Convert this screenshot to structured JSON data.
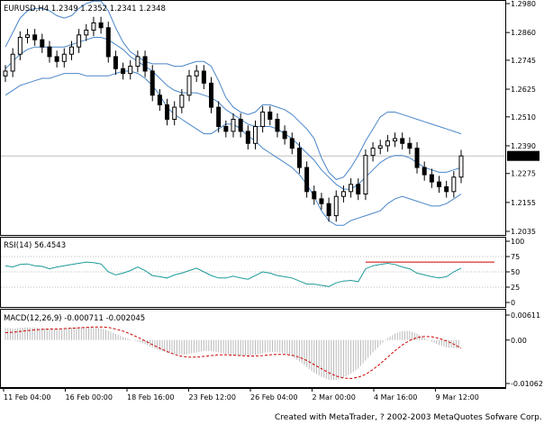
{
  "window": {
    "symbol_title": "EURUSD,H4  1.2349 1.2352 1.2341 1.2348",
    "footer": "Created with MetaTrader, ? 2002-2003 MetaQuotes Sofware Corp."
  },
  "colors": {
    "candle": "#000000",
    "bollinger": "#4a86c8",
    "rsi_line": "#1f9a9a",
    "rsi_level": "#cc0000",
    "macd_hist": "#b8b8b8",
    "macd_signal": "#cc0000",
    "current_price_bg": "#000000",
    "current_price_fg": "#ffffff",
    "grid": "#bfbfbf"
  },
  "price_pane": {
    "ticks": [
      "1.2980",
      "1.2860",
      "1.2745",
      "1.2625",
      "1.2510",
      "1.2390",
      "1.2275",
      "1.2155",
      "1.2035"
    ],
    "current_price": "1.2348"
  },
  "rsi_pane": {
    "title": "RSI(14)  56.4543",
    "ticks": [
      "100",
      "75",
      "50",
      "25",
      "0"
    ]
  },
  "macd_pane": {
    "title": "MACD(12,26,9)  -0.000711  -0.002045",
    "ticks": [
      "0.00611",
      "0.00",
      "-0.01062"
    ]
  },
  "time_axis": [
    "11 Feb 04:00",
    "16 Feb 00:00",
    "18 Feb 16:00",
    "23 Feb 12:00",
    "26 Feb 04:00",
    "2 Mar 00:00",
    "4 Mar 16:00",
    "9 Mar 12:00"
  ],
  "chart_data": {
    "type": "candlestick",
    "title": "EURUSD,H4",
    "price_range": [
      1.2035,
      1.298
    ],
    "price_series": {
      "close": [
        1.27,
        1.277,
        1.284,
        1.285,
        1.283,
        1.28,
        1.276,
        1.274,
        1.277,
        1.28,
        1.285,
        1.287,
        1.29,
        1.288,
        1.276,
        1.271,
        1.269,
        1.272,
        1.276,
        1.27,
        1.26,
        1.256,
        1.25,
        1.255,
        1.26,
        1.268,
        1.27,
        1.265,
        1.255,
        1.247,
        1.245,
        1.25,
        1.245,
        1.24,
        1.247,
        1.253,
        1.25,
        1.245,
        1.242,
        1.238,
        1.23,
        1.22,
        1.217,
        1.215,
        1.21,
        1.218,
        1.22,
        1.223,
        1.219,
        1.235,
        1.238,
        1.239,
        1.241,
        1.242,
        1.24,
        1.238,
        1.23,
        1.227,
        1.224,
        1.222,
        1.22,
        1.226,
        1.2348
      ],
      "bb_upper": [
        1.28,
        1.286,
        1.292,
        1.295,
        1.296,
        1.296,
        1.295,
        1.293,
        1.292,
        1.293,
        1.296,
        1.298,
        1.299,
        1.299,
        1.295,
        1.288,
        1.282,
        1.278,
        1.276,
        1.274,
        1.273,
        1.273,
        1.273,
        1.272,
        1.272,
        1.273,
        1.274,
        1.274,
        1.272,
        1.266,
        1.259,
        1.255,
        1.253,
        1.252,
        1.253,
        1.256,
        1.256,
        1.255,
        1.254,
        1.252,
        1.249,
        1.246,
        1.242,
        1.234,
        1.228,
        1.225,
        1.226,
        1.23,
        1.235,
        1.241,
        1.246,
        1.251,
        1.253,
        1.253,
        1.252,
        1.251,
        1.25,
        1.249,
        1.248,
        1.247,
        1.246,
        1.245,
        1.244
      ],
      "bb_mid": [
        1.271,
        1.274,
        1.277,
        1.279,
        1.28,
        1.28,
        1.28,
        1.28,
        1.28,
        1.281,
        1.282,
        1.283,
        1.284,
        1.284,
        1.283,
        1.281,
        1.279,
        1.276,
        1.274,
        1.272,
        1.27,
        1.267,
        1.264,
        1.262,
        1.261,
        1.261,
        1.261,
        1.26,
        1.259,
        1.257,
        1.254,
        1.252,
        1.25,
        1.248,
        1.247,
        1.247,
        1.247,
        1.246,
        1.244,
        1.242,
        1.239,
        1.236,
        1.233,
        1.229,
        1.226,
        1.223,
        1.221,
        1.221,
        1.223,
        1.226,
        1.229,
        1.232,
        1.234,
        1.235,
        1.235,
        1.234,
        1.232,
        1.23,
        1.229,
        1.228,
        1.228,
        1.229,
        1.23
      ],
      "bb_lower": [
        1.26,
        1.262,
        1.264,
        1.265,
        1.266,
        1.267,
        1.267,
        1.268,
        1.269,
        1.269,
        1.269,
        1.268,
        1.268,
        1.268,
        1.268,
        1.269,
        1.27,
        1.27,
        1.269,
        1.267,
        1.264,
        1.26,
        1.255,
        1.252,
        1.25,
        1.248,
        1.246,
        1.244,
        1.244,
        1.246,
        1.248,
        1.248,
        1.246,
        1.243,
        1.241,
        1.238,
        1.236,
        1.234,
        1.232,
        1.23,
        1.227,
        1.223,
        1.218,
        1.212,
        1.208,
        1.206,
        1.206,
        1.208,
        1.209,
        1.21,
        1.211,
        1.212,
        1.215,
        1.217,
        1.218,
        1.217,
        1.216,
        1.215,
        1.214,
        1.214,
        1.215,
        1.217,
        1.219
      ]
    },
    "rsi": {
      "range": [
        0,
        100
      ],
      "levels": [
        75,
        50,
        25
      ],
      "resistance_level": 66,
      "values": [
        60,
        58,
        62,
        63,
        60,
        59,
        55,
        58,
        60,
        62,
        64,
        66,
        65,
        63,
        50,
        45,
        48,
        52,
        58,
        52,
        44,
        42,
        40,
        45,
        48,
        52,
        56,
        50,
        44,
        40,
        40,
        43,
        40,
        38,
        44,
        50,
        48,
        44,
        42,
        40,
        35,
        30,
        30,
        28,
        26,
        32,
        35,
        36,
        34,
        55,
        60,
        62,
        64,
        62,
        58,
        55,
        48,
        45,
        42,
        40,
        42,
        50,
        56
      ]
    },
    "macd": {
      "range": [
        -0.01062,
        0.00611
      ],
      "histogram": [
        0.003,
        0.0028,
        0.003,
        0.0031,
        0.003,
        0.0029,
        0.0027,
        0.0027,
        0.0028,
        0.003,
        0.0031,
        0.0032,
        0.0031,
        0.0029,
        0.0023,
        0.0015,
        0.0008,
        0.0002,
        -0.0004,
        -0.001,
        -0.0018,
        -0.0025,
        -0.0031,
        -0.0034,
        -0.0036,
        -0.0034,
        -0.003,
        -0.0027,
        -0.0027,
        -0.003,
        -0.0034,
        -0.0037,
        -0.0038,
        -0.0038,
        -0.0036,
        -0.0032,
        -0.0029,
        -0.003,
        -0.0033,
        -0.004,
        -0.0052,
        -0.0066,
        -0.008,
        -0.009,
        -0.0097,
        -0.0098,
        -0.0092,
        -0.0082,
        -0.007,
        -0.005,
        -0.003,
        -0.0012,
        0.0005,
        0.0016,
        0.0022,
        0.0022,
        0.0016,
        0.0006,
        -0.0004,
        -0.0012,
        -0.0018,
        -0.002,
        -0.002
      ],
      "signal": [
        0.0018,
        0.0019,
        0.0021,
        0.0023,
        0.0025,
        0.0026,
        0.0027,
        0.0027,
        0.0028,
        0.0029,
        0.003,
        0.0031,
        0.0032,
        0.0032,
        0.0031,
        0.0027,
        0.0022,
        0.0015,
        0.0007,
        -0.0002,
        -0.0011,
        -0.002,
        -0.0028,
        -0.0035,
        -0.004,
        -0.0042,
        -0.0042,
        -0.004,
        -0.0038,
        -0.0036,
        -0.0036,
        -0.0037,
        -0.0038,
        -0.0039,
        -0.0039,
        -0.0038,
        -0.0036,
        -0.0035,
        -0.0035,
        -0.0037,
        -0.0042,
        -0.005,
        -0.006,
        -0.007,
        -0.008,
        -0.0088,
        -0.0093,
        -0.0094,
        -0.0091,
        -0.0084,
        -0.0072,
        -0.0058,
        -0.0042,
        -0.0026,
        -0.0012,
        -0.0001,
        0.0006,
        0.0009,
        0.0008,
        0.0004,
        -0.0002,
        -0.001,
        -0.002
      ]
    }
  }
}
